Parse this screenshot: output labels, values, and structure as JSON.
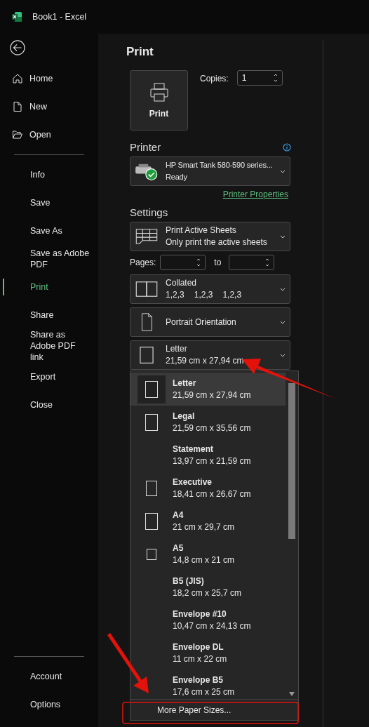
{
  "window": {
    "title": "Book1  -  Excel"
  },
  "sidebar": {
    "top_items": [
      {
        "label": "Home",
        "kind": "home"
      },
      {
        "label": "New",
        "kind": "new"
      },
      {
        "label": "Open",
        "kind": "open"
      }
    ],
    "items": [
      {
        "label": "Info",
        "selected": false
      },
      {
        "label": "Save",
        "selected": false
      },
      {
        "label": "Save As",
        "selected": false
      },
      {
        "label": "Save as Adobe PDF",
        "selected": false
      },
      {
        "label": "Print",
        "selected": true
      },
      {
        "label": "Share",
        "selected": false
      },
      {
        "label": "Share as Adobe PDF link",
        "selected": false
      },
      {
        "label": "Export",
        "selected": false
      },
      {
        "label": "Close",
        "selected": false
      }
    ],
    "bottom_items": [
      {
        "label": "Account"
      },
      {
        "label": "Options"
      }
    ]
  },
  "print": {
    "title": "Print",
    "button": "Print",
    "copies_label": "Copies:",
    "copies": "1"
  },
  "printer": {
    "heading": "Printer",
    "name": "HP Smart Tank 580-590 series...",
    "status": "Ready",
    "properties_link": "Printer Properties"
  },
  "settings": {
    "heading": "Settings",
    "pages_label": "Pages:",
    "to_label": "to",
    "dropdowns": [
      {
        "kind": "sheets",
        "title": "Print Active Sheets",
        "sub": [
          "Only print the active sheets"
        ]
      },
      {
        "kind": "collated",
        "title": "Collated",
        "sub": [
          "1,2,3",
          "1,2,3",
          "1,2,3"
        ]
      },
      {
        "kind": "portrait",
        "title": "Portrait Orientation"
      },
      {
        "kind": "paper",
        "title": "Letter",
        "sub": [
          "21,59 cm x 27,94 cm"
        ]
      }
    ]
  },
  "paper_list": {
    "items": [
      {
        "name": "Letter",
        "size": "21,59 cm x 27,94 cm",
        "kind": "large",
        "selected": true
      },
      {
        "name": "Legal",
        "size": "21,59 cm x 35,56 cm",
        "kind": "large",
        "selected": false
      },
      {
        "name": "Statement",
        "size": "13,97 cm x 21,59 cm",
        "selected": false
      },
      {
        "name": "Executive",
        "size": "18,41 cm x 26,67 cm",
        "kind": "medium",
        "selected": false
      },
      {
        "name": "A4",
        "size": "21 cm x 29,7 cm",
        "kind": "large",
        "selected": false
      },
      {
        "name": "A5",
        "size": "14,8 cm x 21 cm",
        "kind": "small",
        "selected": false
      },
      {
        "name": "B5 (JIS)",
        "size": "18,2 cm x 25,7 cm",
        "selected": false
      },
      {
        "name": "Envelope #10",
        "size": "10,47 cm x 24,13 cm",
        "selected": false
      },
      {
        "name": "Envelope DL",
        "size": "11 cm x 22 cm",
        "selected": false
      },
      {
        "name": "Envelope B5",
        "size": "17,6 cm x 25 cm",
        "selected": false
      }
    ],
    "footer": "More Paper Sizes..."
  }
}
